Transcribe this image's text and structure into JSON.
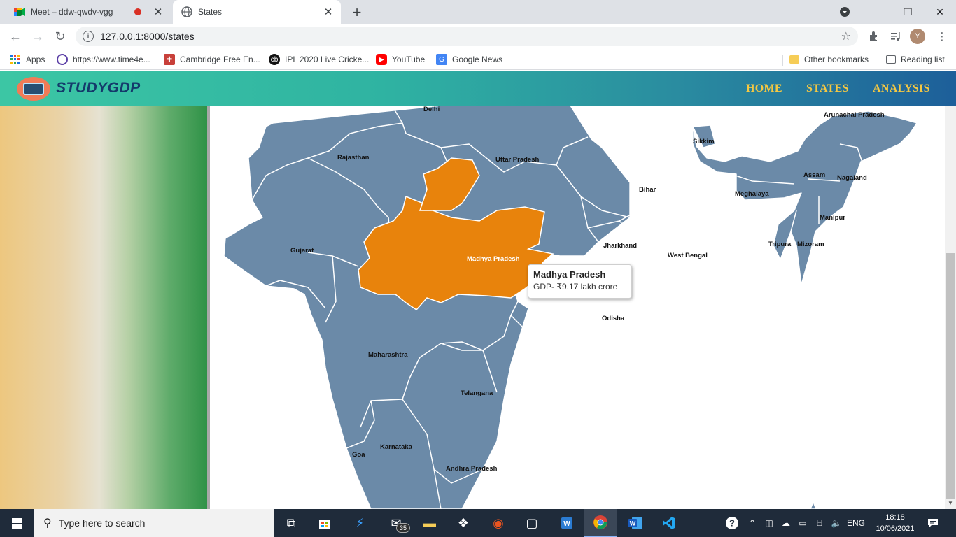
{
  "browser": {
    "tabs": [
      {
        "title": "Meet – ddw-qwdv-vgg",
        "recording": true
      },
      {
        "title": "States",
        "active": true
      }
    ],
    "url": "127.0.0.1:8000/states",
    "profile_initial": "Y",
    "bookmarks": [
      "Apps",
      "https://www.time4e...",
      "Cambridge Free En...",
      "IPL 2020 Live Cricke...",
      "YouTube",
      "Google News"
    ],
    "other_bookmarks": "Other bookmarks",
    "reading_list": "Reading list"
  },
  "site": {
    "brand": "STUDYGDP",
    "nav": [
      "HOME",
      "STATES",
      "ANALYSIS"
    ]
  },
  "map": {
    "highlight_color": "#e8830c",
    "state_color": "#6b8aa8",
    "state_labels": [
      "Delhi",
      "Rajasthan",
      "Uttar Pradesh",
      "Arunachal Pradesh",
      "Sikkim",
      "Assam",
      "Nagaland",
      "Meghalaya",
      "Bihar",
      "Manipur",
      "Gujarat",
      "Madhya Pradesh",
      "Jharkhand",
      "West Bengal",
      "Tripura",
      "Mizoram",
      "Odisha",
      "Maharashtra",
      "Telangana",
      "Karnataka",
      "Goa",
      "Andhra Pradesh"
    ],
    "tooltip": {
      "title": "Madhya Pradesh",
      "value": "GDP- ₹9.17 lakh crore"
    }
  },
  "taskbar": {
    "search_placeholder": "Type here to search",
    "mail_badge": "35",
    "language": "ENG",
    "time": "18:18",
    "date": "10/06/2021"
  }
}
